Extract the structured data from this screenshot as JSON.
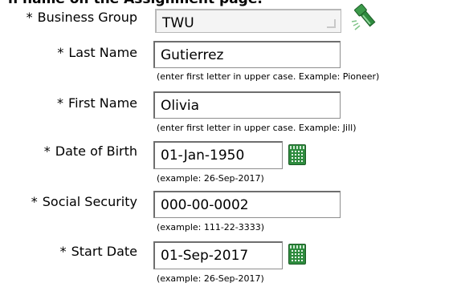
{
  "page": {
    "partial_title": "n name on the Assignment page."
  },
  "form": {
    "business_group": {
      "label": "Business Group",
      "value": "TWU"
    },
    "last_name": {
      "label": "Last Name",
      "value": "Gutierrez",
      "hint": "(enter first letter in upper case. Example: Pioneer)"
    },
    "first_name": {
      "label": "First Name",
      "value": "Olivia",
      "hint": "(enter first letter in upper case. Example: Jill)"
    },
    "date_of_birth": {
      "label": "Date of Birth",
      "value": "01-Jan-1950",
      "hint": "(example: 26-Sep-2017)"
    },
    "social_security": {
      "label": "Social Security",
      "value": "000-00-0002",
      "hint": "(example: 111-22-3333)"
    },
    "start_date": {
      "label": "Start Date",
      "value": "01-Sep-2017",
      "hint": "(example: 26-Sep-2017)"
    },
    "required_marker": "*"
  },
  "icons": {
    "search": "flashlight-search-icon",
    "calendar": "calendar-icon"
  },
  "colors": {
    "icon_green": "#2e8b3e"
  }
}
